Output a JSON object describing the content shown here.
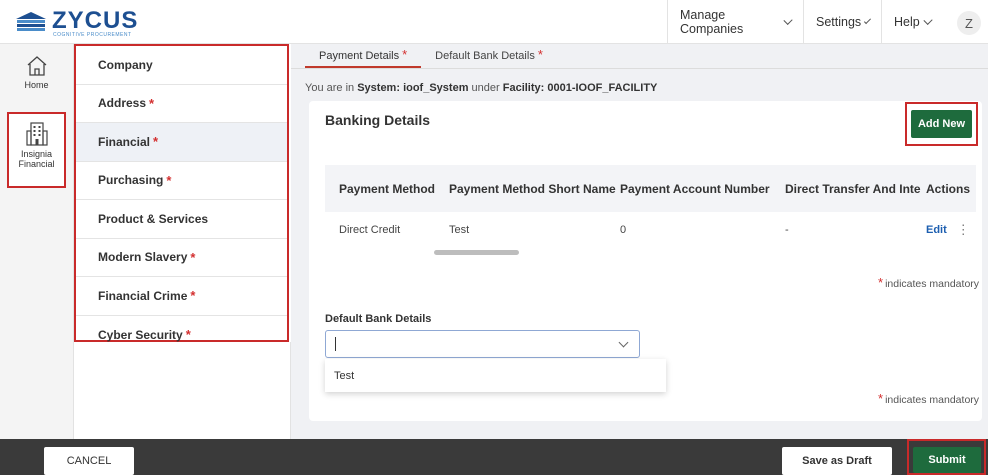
{
  "brand": {
    "name": "ZYCUS",
    "tagline": "COGNITIVE PROCUREMENT",
    "primary_color": "#1d4f91",
    "accent_red": "#c92a2a",
    "green": "#1e6b3d"
  },
  "header": {
    "menus": [
      {
        "label": "Manage Companies"
      },
      {
        "label": "Settings"
      },
      {
        "label": "Help"
      }
    ],
    "avatar_initial": "Z"
  },
  "rail": {
    "home_label": "Home",
    "org_label_line1": "Insignia",
    "org_label_line2": "Financial"
  },
  "sections": [
    {
      "label": "Company",
      "required": false
    },
    {
      "label": "Address",
      "required": true
    },
    {
      "label": "Financial",
      "required": true,
      "active": true
    },
    {
      "label": "Purchasing",
      "required": true
    },
    {
      "label": "Product & Services",
      "required": false
    },
    {
      "label": "Modern Slavery",
      "required": true
    },
    {
      "label": "Financial Crime",
      "required": true
    },
    {
      "label": "Cyber Security",
      "required": true
    }
  ],
  "required_marker": "*",
  "tabs": [
    {
      "label": "Payment Details",
      "required": true,
      "active": true
    },
    {
      "label": "Default Bank Details",
      "required": true
    }
  ],
  "breadcrumb": {
    "prefix": "You are in ",
    "system_label": "System: ",
    "system_value": "ioof_System",
    "mid": " under ",
    "facility_label": "Facility: ",
    "facility_value": "0001-IOOF_FACILITY"
  },
  "banking": {
    "title": "Banking Details",
    "add_new_label": "Add New",
    "columns": [
      "Payment Method",
      "Payment Method Short Name",
      "Payment Account Number",
      "Direct Transfer And International",
      "Actions"
    ],
    "rows": [
      {
        "method": "Direct Credit",
        "short_name": "Test",
        "account_number": "0",
        "direct_transfer": "-",
        "edit_label": "Edit",
        "more_glyph": "⋮"
      }
    ],
    "mandatory_note": "indicates mandatory"
  },
  "default_bank": {
    "field_label": "Default Bank Details",
    "value": "",
    "options": [
      "Test"
    ],
    "mandatory_note": "indicates mandatory"
  },
  "footer": {
    "cancel_label": "CANCEL",
    "draft_label": "Save as Draft",
    "submit_label": "Submit"
  }
}
